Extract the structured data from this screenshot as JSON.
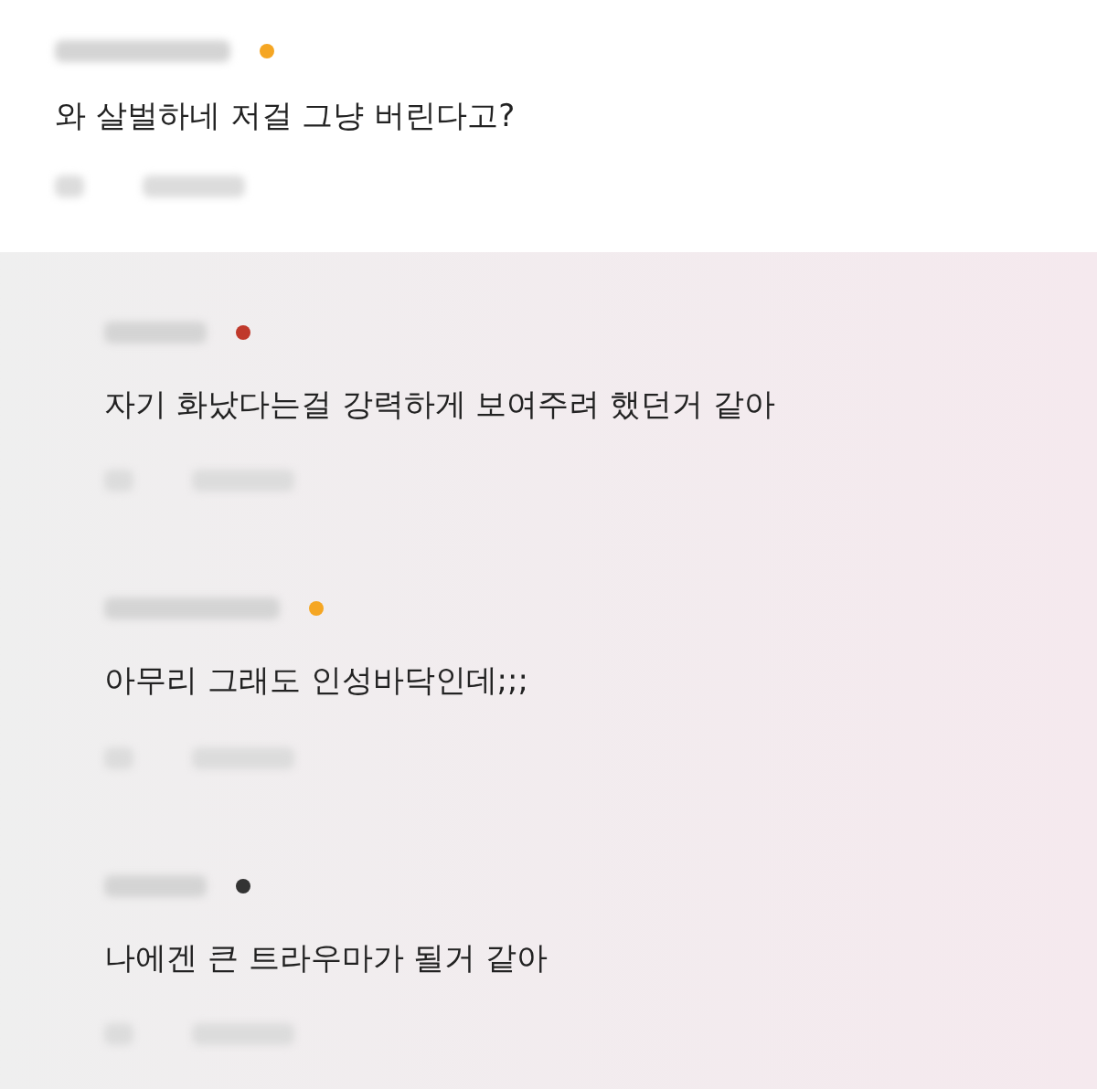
{
  "comment": {
    "color": "#f5a623",
    "text": "와 살벌하네 저걸 그냥 버린다고?"
  },
  "replies": [
    {
      "color": "#c0392b",
      "text": "자기 화났다는걸 강력하게 보여주려 했던거 같아"
    },
    {
      "color": "#f5a623",
      "text": "아무리 그래도 인성바닥인데;;;"
    },
    {
      "color": "#333333",
      "text": "나에겐 큰 트라우마가 될거 같아"
    }
  ]
}
